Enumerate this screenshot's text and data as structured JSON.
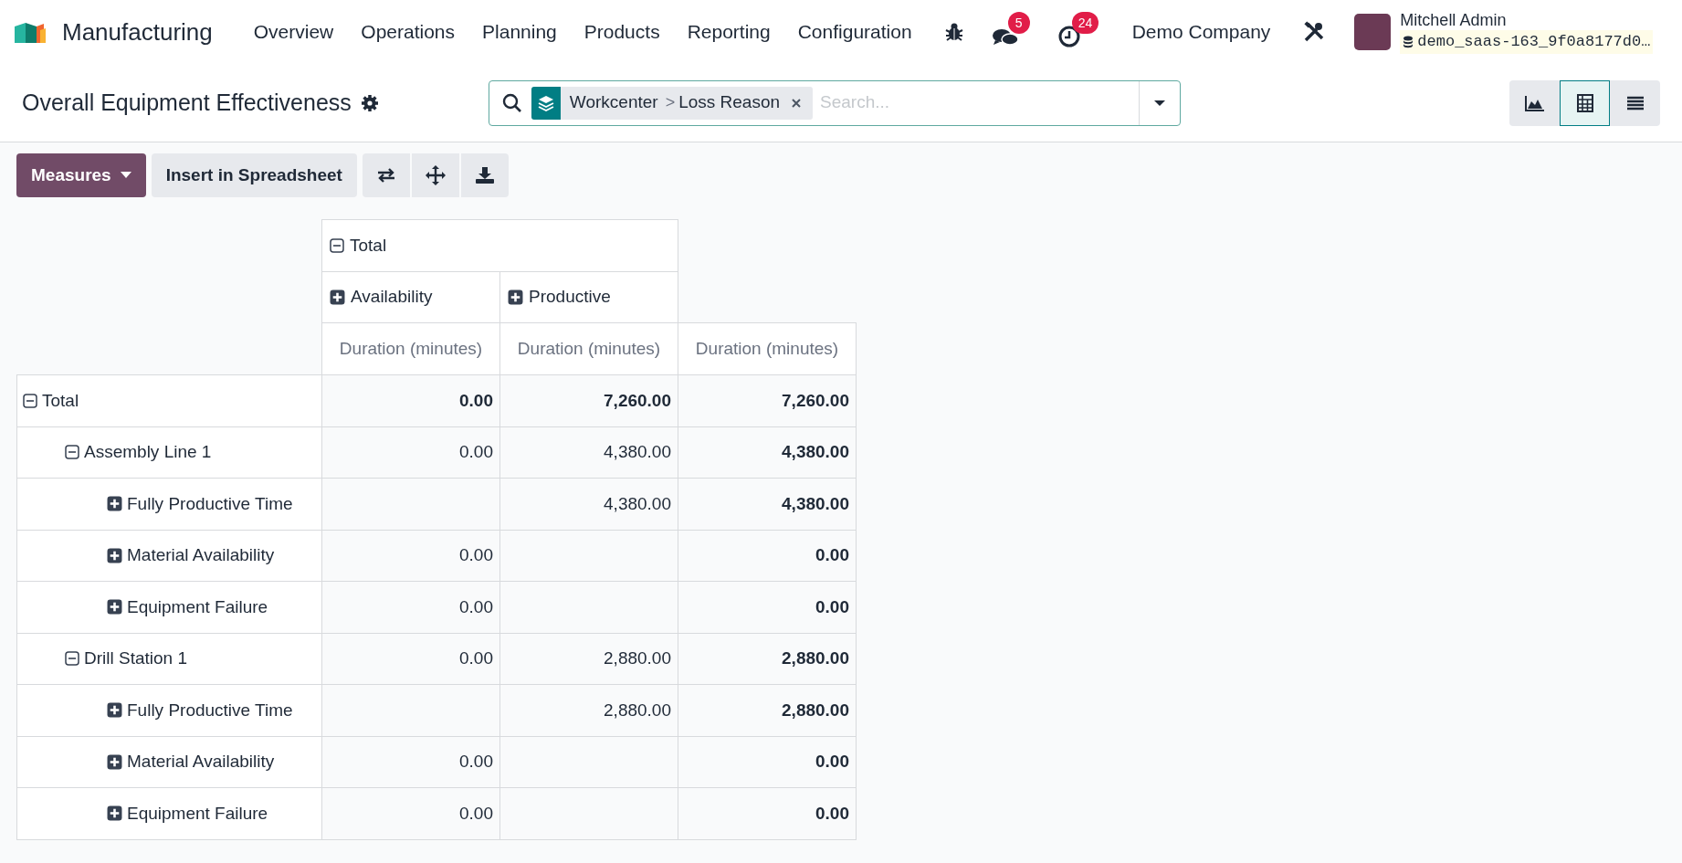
{
  "navbar": {
    "app_name": "Manufacturing",
    "menu": [
      "Overview",
      "Operations",
      "Planning",
      "Products",
      "Reporting",
      "Configuration"
    ],
    "messages_badge": "5",
    "activities_badge": "24",
    "company": "Demo Company",
    "user_name": "Mitchell Admin",
    "database": "demo_saas-163_9f0a8177d0…"
  },
  "control_panel": {
    "title": "Overall Equipment Effectiveness",
    "facet": {
      "groups": [
        "Workcenter",
        "Loss Reason"
      ],
      "separator": ">"
    },
    "search_placeholder": "Search...",
    "views": [
      {
        "kind": "graph",
        "selected": false
      },
      {
        "kind": "pivot",
        "selected": true
      },
      {
        "kind": "list",
        "selected": false
      }
    ]
  },
  "toolbar": {
    "measures": "Measures",
    "insert": "Insert in Spreadsheet"
  },
  "pivot": {
    "col_header": {
      "label": "Total",
      "expanded": true,
      "children": [
        {
          "label": "Availability",
          "expanded": false
        },
        {
          "label": "Productive",
          "expanded": false
        }
      ]
    },
    "measures": [
      "Duration (minutes)",
      "Duration (minutes)",
      "Duration (minutes)"
    ],
    "rows": [
      {
        "label": "Total",
        "expanded": true,
        "values": {
          "availability": "0.00",
          "productive": "7,260.00",
          "total": "7,260.00"
        },
        "children": [
          {
            "label": "Assembly Line 1",
            "expanded": true,
            "values": {
              "availability": "0.00",
              "productive": "4,380.00",
              "total": "4,380.00"
            },
            "children": [
              {
                "label": "Fully Productive Time",
                "expanded": false,
                "values": {
                  "productive": "4,380.00",
                  "total": "4,380.00"
                }
              },
              {
                "label": "Material Availability",
                "expanded": false,
                "values": {
                  "availability": "0.00",
                  "total": "0.00"
                }
              },
              {
                "label": "Equipment Failure",
                "expanded": false,
                "values": {
                  "availability": "0.00",
                  "total": "0.00"
                }
              }
            ]
          },
          {
            "label": "Drill Station 1",
            "expanded": true,
            "values": {
              "availability": "0.00",
              "productive": "2,880.00",
              "total": "2,880.00"
            },
            "children": [
              {
                "label": "Fully Productive Time",
                "expanded": false,
                "values": {
                  "productive": "2,880.00",
                  "total": "2,880.00"
                }
              },
              {
                "label": "Material Availability",
                "expanded": false,
                "values": {
                  "availability": "0.00",
                  "total": "0.00"
                }
              },
              {
                "label": "Equipment Failure",
                "expanded": false,
                "values": {
                  "availability": "0.00",
                  "total": "0.00"
                }
              }
            ]
          }
        ]
      }
    ]
  }
}
